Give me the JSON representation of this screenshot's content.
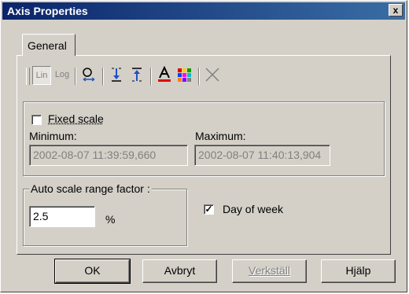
{
  "window": {
    "title": "Axis Properties",
    "close_label": "x"
  },
  "tabs": [
    {
      "label": "General"
    }
  ],
  "toolbar": {
    "lin_label": "Lin",
    "log_label": "Log",
    "icons": [
      "lin-scale-icon",
      "log-scale-icon",
      "zoom-axis-icon",
      "align-bottom-icon",
      "align-top-icon",
      "text-color-icon",
      "color-palette-icon",
      "delete-icon"
    ]
  },
  "scale": {
    "fixed_scale_label": "Fixed scale",
    "fixed_scale_checked": false,
    "minimum_label": "Minimum:",
    "minimum_value": "2002-08-07 11:39:59,660",
    "maximum_label": "Maximum:",
    "maximum_value": "2002-08-07 11:40:13,904"
  },
  "auto_scale": {
    "legend": "Auto scale range factor :",
    "value": "2.5",
    "unit": "%"
  },
  "day_of_week": {
    "label": "Day of week",
    "checked": true
  },
  "buttons": {
    "ok": "OK",
    "cancel": "Avbryt",
    "apply": "Verkställ",
    "help": "Hjälp"
  },
  "colors": {
    "title_start": "#0a246a",
    "title_end": "#3a6ea5",
    "face": "#d4d0c8"
  }
}
